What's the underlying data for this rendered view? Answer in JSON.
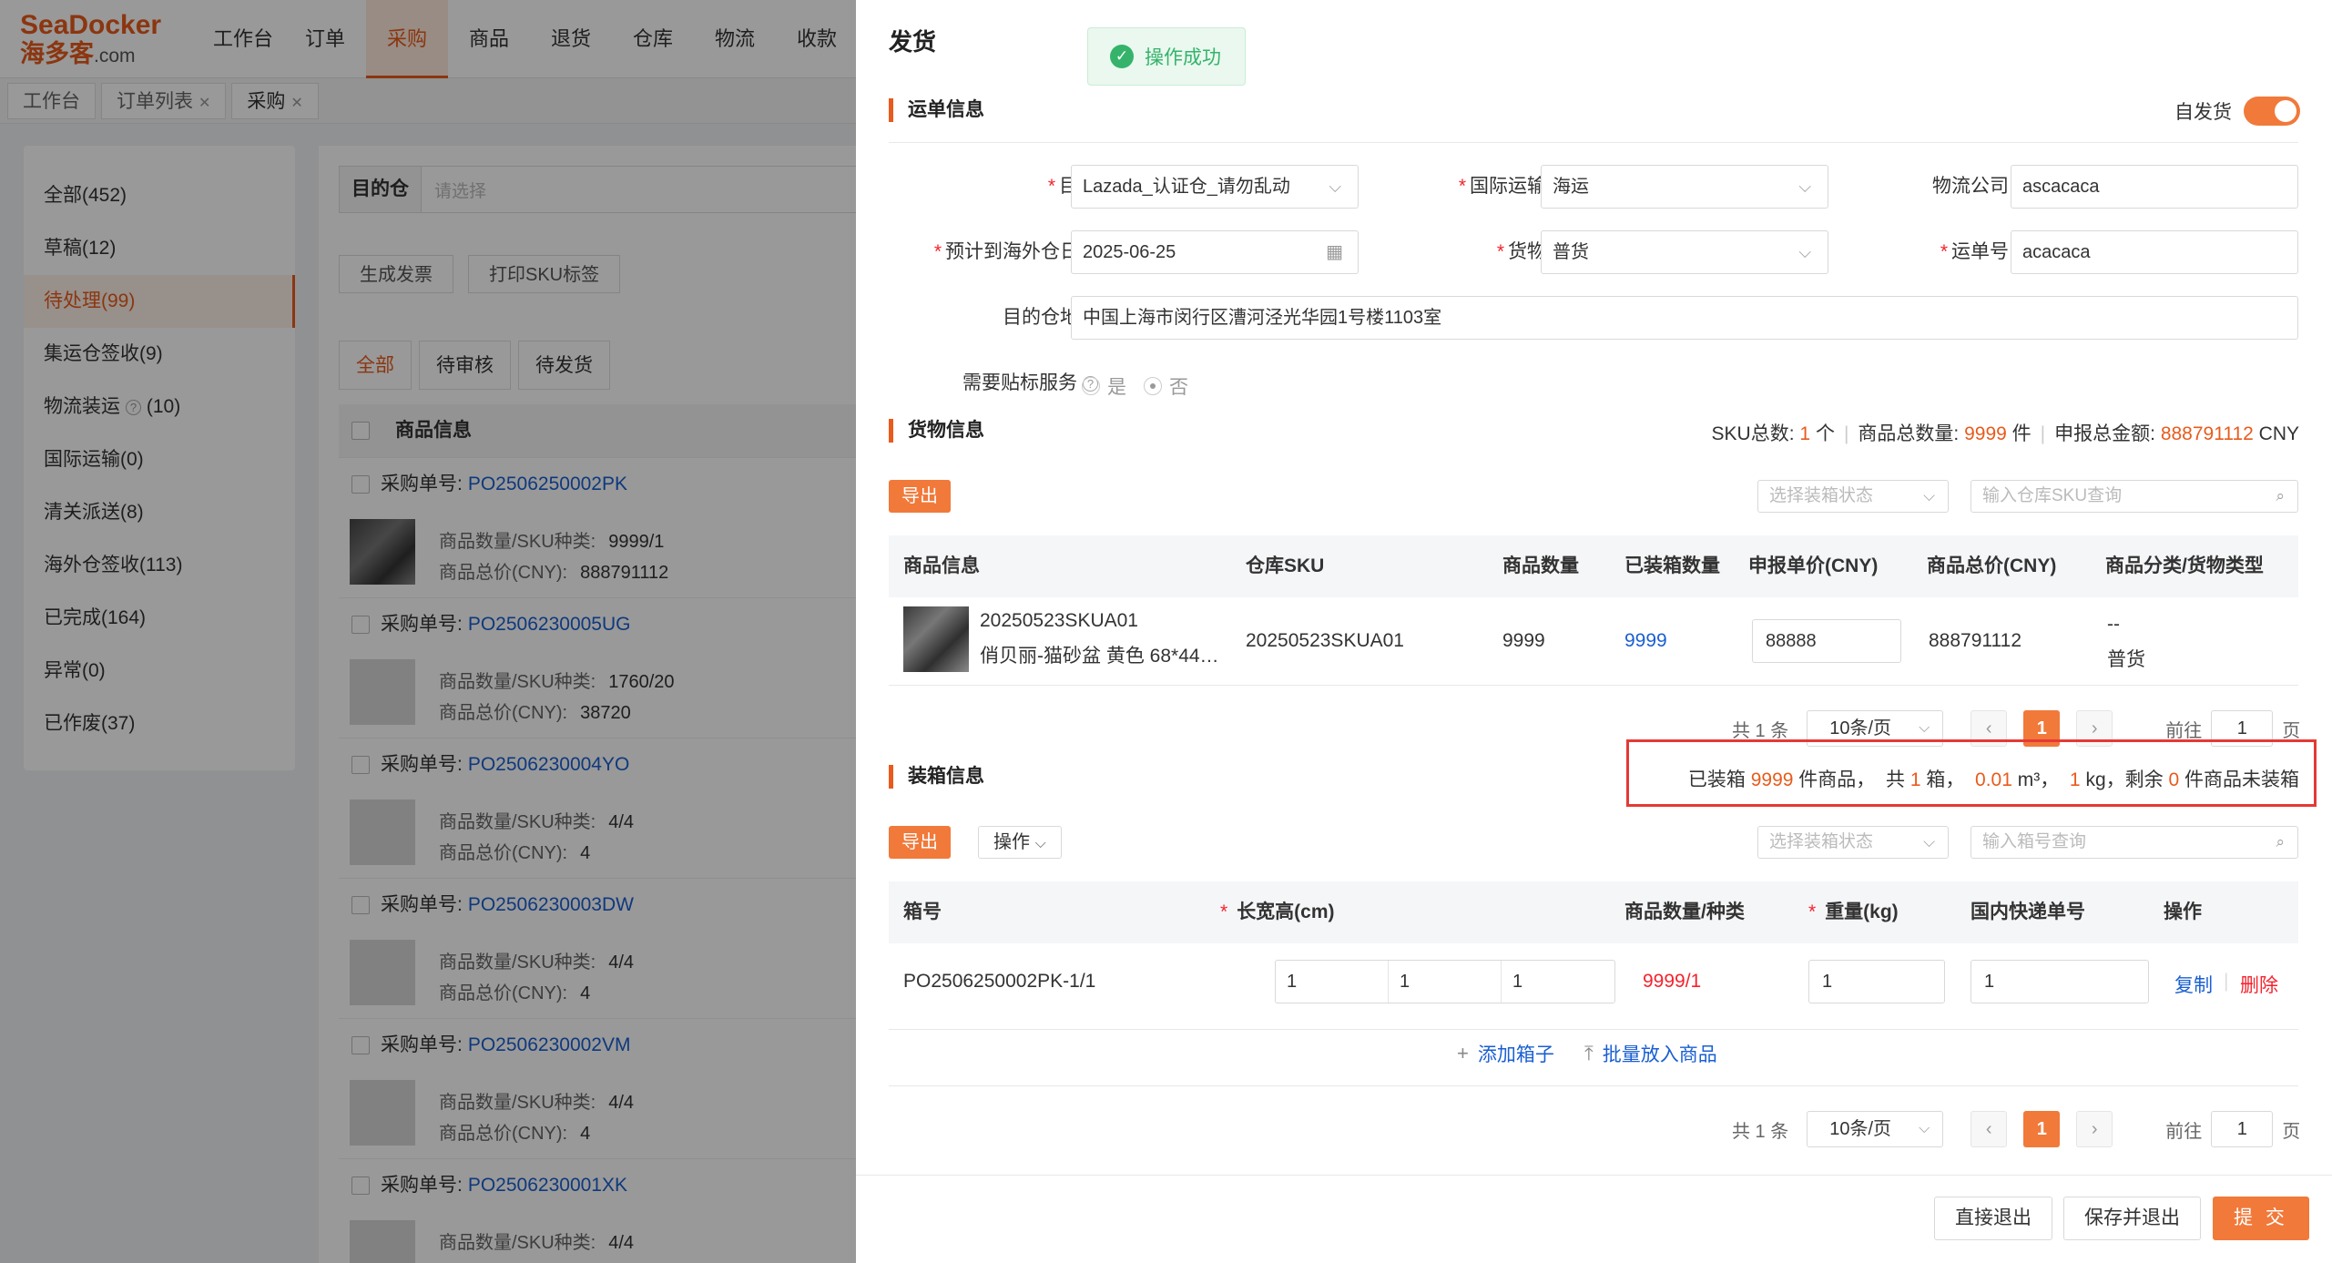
{
  "app": {
    "logo_line1": "SeaDocker",
    "logo_line2": "海多客",
    "logo_suffix": ".com",
    "nav": [
      "工作台",
      "订单",
      "采购",
      "商品",
      "退货",
      "仓库",
      "物流",
      "收款"
    ],
    "nav_active": "采购",
    "page_tabs": [
      "工作台",
      "订单列表",
      "采购"
    ],
    "sidebar": [
      "全部(452)",
      "草稿(12)",
      "待处理(99)",
      "集运仓签收(9)",
      "物流装运",
      "国际运输(0)",
      "清关派送(8)",
      "海外仓签收(113)",
      "已完成(164)",
      "异常(0)",
      "已作废(37)"
    ],
    "sidebar_logistics_count": "(10)",
    "filter_label": "目的仓",
    "filter_placeholder": "请选择",
    "buttons": [
      "生成发票",
      "打印SKU标签"
    ],
    "status_tabs": [
      "全部",
      "待审核",
      "待发货"
    ],
    "list_header": "商品信息",
    "po_label": "采购单号:",
    "qty_label": "商品数量/SKU种类:",
    "total_label": "商品总价(CNY):",
    "orders": [
      {
        "po": "PO2506250002PK",
        "qty": "9999/1",
        "total": "888791112"
      },
      {
        "po": "PO2506230005UG",
        "qty": "1760/20",
        "total": "38720"
      },
      {
        "po": "PO2506230004YO",
        "qty": "4/4",
        "total": "4"
      },
      {
        "po": "PO2506230003DW",
        "qty": "4/4",
        "total": "4"
      },
      {
        "po": "PO2506230002VM",
        "qty": "4/4",
        "total": "4"
      },
      {
        "po": "PO2506230001XK",
        "qty": "4/4",
        "total": ""
      }
    ]
  },
  "drawer": {
    "title": "发货",
    "toast": "操作成功",
    "waybill": {
      "section_title": "运单信息",
      "self_ship_label": "自发货",
      "self_ship_on": true,
      "dest_wh_label": "目的仓",
      "dest_wh_value": "Lazada_认证仓_请勿乱动",
      "intl_method_label": "国际运输方式",
      "intl_method_value": "海运",
      "carrier_label": "物流公司",
      "carrier_value": "ascacaca",
      "eta_label": "预计到海外仓日期",
      "eta_value": "2025-06-25",
      "cargo_type_label": "货物类型",
      "cargo_type_value": "普货",
      "tracking_label": "运单号",
      "tracking_value": "acacaca",
      "address_label": "目的仓地址",
      "address_value": "中国上海市闵行区漕河泾光华园1号楼1103室",
      "label_service_label": "需要贴标服务",
      "opt_yes": "是",
      "opt_no": "否",
      "label_service_value": "否"
    },
    "goods": {
      "section_title": "货物信息",
      "sku_total_label": "SKU总数:",
      "sku_total": "1",
      "sku_unit": "个",
      "qty_total_label": "商品总数量:",
      "qty_total": "9999",
      "qty_unit": "件",
      "amount_label": "申报总金额:",
      "amount": "888791112",
      "currency": "CNY",
      "export": "导出",
      "status_placeholder": "选择装箱状态",
      "sku_search_placeholder": "输入仓库SKU查询",
      "columns": [
        "商品信息",
        "仓库SKU",
        "商品数量",
        "已装箱数量",
        "申报单价(CNY)",
        "商品总价(CNY)",
        "商品分类/货物类型"
      ],
      "row": {
        "sku_code": "20250523SKUA01",
        "name": "俏贝丽-猫砂盆 黄色 68*44…",
        "wh_sku": "20250523SKUA01",
        "qty": "9999",
        "packed": "9999",
        "unit_price": "88888",
        "total": "888791112",
        "category": "--",
        "cargo_type": "普货"
      },
      "pager": {
        "total": "共 1 条",
        "per_page": "10条/页",
        "current": "1",
        "goto": "前往",
        "goto_value": "1",
        "page_unit": "页"
      }
    },
    "packing": {
      "section_title": "装箱信息",
      "summary_packed_pre": "已装箱",
      "packed_count": "9999",
      "summary_goods": "件商品，",
      "summary_boxes_pre": "共",
      "box_count": "1",
      "summary_boxes_unit": "箱，",
      "volume": "0.01",
      "volume_unit": "m³，",
      "weight": "1",
      "weight_unit": "kg，剩余",
      "remaining": "0",
      "summary_end": "件商品未装箱",
      "export": "导出",
      "actions": "操作",
      "status_placeholder": "选择装箱状态",
      "box_search_placeholder": "输入箱号查询",
      "columns": [
        "箱号",
        "长宽高(cm)",
        "商品数量/种类",
        "重量(kg)",
        "国内快递单号",
        "操作"
      ],
      "row": {
        "box_no": "PO2506250002PK-1/1",
        "length": "1",
        "width": "1",
        "height": "1",
        "qty_kinds": "9999/1",
        "weight": "1",
        "express_no": "1",
        "copy": "复制",
        "delete": "删除"
      },
      "add_box": "添加箱子",
      "batch_put": "批量放入商品",
      "pager": {
        "total": "共 1 条",
        "per_page": "10条/页",
        "current": "1",
        "goto": "前往",
        "goto_value": "1",
        "page_unit": "页"
      }
    },
    "footer": {
      "exit": "直接退出",
      "save_exit": "保存并退出",
      "submit": "提 交"
    }
  }
}
